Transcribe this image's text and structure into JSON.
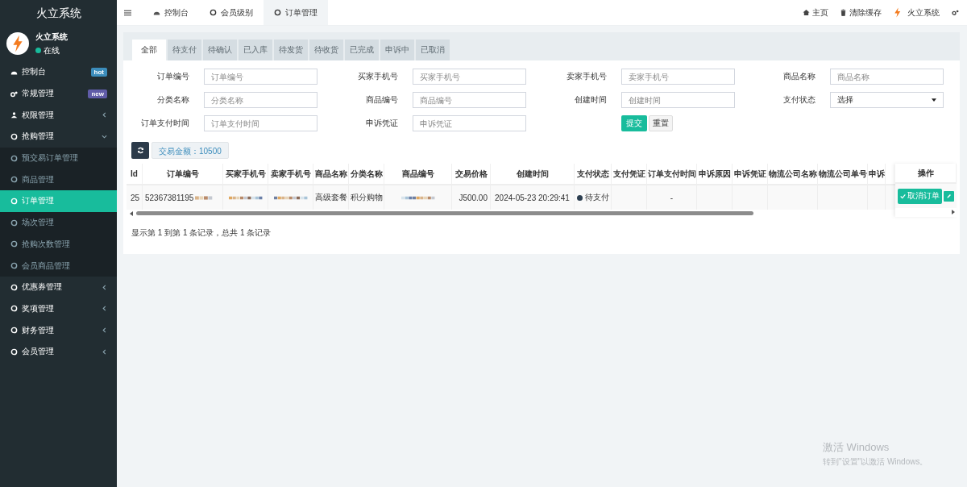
{
  "brand": "火立系统",
  "user": {
    "name": "火立系统",
    "status": "在线"
  },
  "sidebar": {
    "items": [
      {
        "label": "控制台",
        "badge": {
          "text": "hot",
          "color": "#3c8dbc"
        },
        "selected": false
      },
      {
        "label": "常规管理",
        "badge": {
          "text": "new",
          "color": "#605ca8"
        },
        "selected": false
      },
      {
        "label": "权限管理",
        "selected": false,
        "expanded": false
      },
      {
        "label": "抢购管理",
        "selected": false,
        "expanded": true,
        "children": [
          {
            "label": "预交易订单管理",
            "selected": false
          },
          {
            "label": "商品管理",
            "selected": false
          },
          {
            "label": "订单管理",
            "selected": true
          },
          {
            "label": "场次管理",
            "selected": false
          },
          {
            "label": "抢购次数管理",
            "selected": false
          },
          {
            "label": "会员商品管理",
            "selected": false
          }
        ]
      },
      {
        "label": "优惠券管理",
        "selected": false,
        "expanded": false
      },
      {
        "label": "奖项管理",
        "selected": false,
        "expanded": false
      },
      {
        "label": "财务管理",
        "selected": false,
        "expanded": false
      },
      {
        "label": "会员管理",
        "selected": false,
        "expanded": false
      }
    ]
  },
  "topbar": {
    "tabs": [
      {
        "label": "控制台",
        "selected": false
      },
      {
        "label": "会员级别",
        "selected": false
      },
      {
        "label": "订单管理",
        "selected": true
      }
    ],
    "links": [
      "主页",
      "清除缓存",
      "火立系统"
    ]
  },
  "filter_tabs": [
    {
      "label": "全部",
      "selected": true
    },
    {
      "label": "待支付",
      "selected": false
    },
    {
      "label": "待确认",
      "selected": false
    },
    {
      "label": "已入库",
      "selected": false
    },
    {
      "label": "待发货",
      "selected": false
    },
    {
      "label": "待收货",
      "selected": false
    },
    {
      "label": "已完成",
      "selected": false
    },
    {
      "label": "申诉中",
      "selected": false
    },
    {
      "label": "已取消",
      "selected": false
    }
  ],
  "form": {
    "fields": [
      {
        "label": "订单编号",
        "kind": "input",
        "placeholder": "订单编号"
      },
      {
        "label": "买家手机号",
        "kind": "input",
        "placeholder": "买家手机号"
      },
      {
        "label": "卖家手机号",
        "kind": "input",
        "placeholder": "卖家手机号"
      },
      {
        "label": "商品名称",
        "kind": "input",
        "placeholder": "商品名称"
      },
      {
        "label": "分类名称",
        "kind": "input",
        "placeholder": "分类名称"
      },
      {
        "label": "商品编号",
        "kind": "input",
        "placeholder": "商品编号"
      },
      {
        "label": "创建时间",
        "kind": "input",
        "placeholder": "创建时间"
      },
      {
        "label": "支付状态",
        "kind": "select",
        "value": "选择"
      },
      {
        "label": "订单支付时间",
        "kind": "input",
        "placeholder": "订单支付时间"
      },
      {
        "label": "申诉凭证",
        "kind": "input",
        "placeholder": "申诉凭证"
      }
    ],
    "submit": "提交",
    "reset": "重置"
  },
  "toolbar": {
    "total": "交易金额：10500"
  },
  "table": {
    "columns": [
      "Id",
      "订单编号",
      "买家手机号",
      "卖家手机号",
      "商品名称",
      "分类名称",
      "商品编号",
      "交易价格",
      "创建时间",
      "支付状态",
      "支付凭证",
      "订单支付时间",
      "申诉原因",
      "申诉凭证",
      "物流公司名称",
      "物流公司单号",
      "申诉",
      "操作"
    ],
    "rows": [
      {
        "cells": [
          {
            "kind": "text",
            "text": "25"
          },
          {
            "kind": "text",
            "text": "52367381195",
            "mosaic": true
          },
          {
            "kind": "mosaic"
          },
          {
            "kind": "mosaic"
          },
          {
            "kind": "text",
            "text": "高级套餐"
          },
          {
            "kind": "text",
            "text": "积分购物"
          },
          {
            "kind": "mosaic"
          },
          {
            "kind": "text",
            "text": "J500.00"
          },
          {
            "kind": "text",
            "text": "2024-05-23 20:29:41"
          },
          {
            "kind": "status",
            "text": "待支付"
          },
          {
            "kind": "empty"
          },
          {
            "kind": "text",
            "text": "-"
          },
          {
            "kind": "empty"
          },
          {
            "kind": "empty"
          },
          {
            "kind": "empty"
          },
          {
            "kind": "empty"
          },
          {
            "kind": "empty"
          }
        ],
        "action": "取消订单"
      }
    ]
  },
  "pagination": "显示第 1 到第 1 条记录，总共 1 条记录",
  "activation": {
    "title": "激活 Windows",
    "text": "转到\"设置\"以激活 Windows。"
  }
}
